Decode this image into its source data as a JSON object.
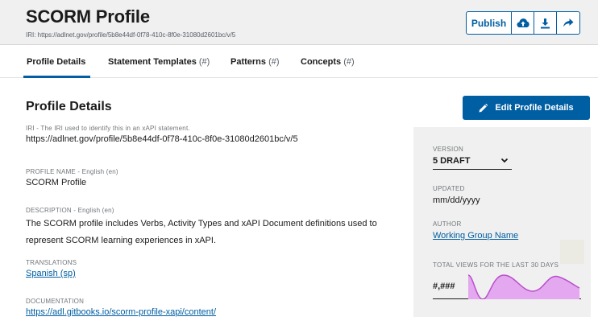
{
  "header": {
    "title": "SCORM Profile",
    "iri_line": "IRI: https://adlnet.gov/profile/5b8e44df-0f78-410c-8f0e-31080d2601bc/v/5",
    "toolbar": {
      "publish_label": "Publish",
      "icons": [
        "cloud-upload-icon",
        "download-icon",
        "share-icon"
      ]
    }
  },
  "tabs": [
    {
      "label": "Profile Details",
      "count": ""
    },
    {
      "label": "Statement Templates",
      "count": "(#)"
    },
    {
      "label": "Patterns",
      "count": "(#)"
    },
    {
      "label": "Concepts",
      "count": "(#)"
    }
  ],
  "main": {
    "section_title": "Profile Details",
    "edit_button": "Edit Profile Details",
    "iri": {
      "label": "IRI - The IRI used to identify this in an xAPI statement.",
      "value": "https://adlnet.gov/profile/5b8e44df-0f78-410c-8f0e-31080d2601bc/v/5"
    },
    "profile_name": {
      "label": "PROFILE NAME - English (en)",
      "value": "SCORM Profile"
    },
    "description": {
      "label": "DESCRIPTION - English (en)",
      "value": "The SCORM profile includes Verbs, Activity Types and xAPI Document definitions used to represent SCORM learning experiences in xAPI."
    },
    "translations": {
      "label": "TRANSLATIONS",
      "value": "Spanish (sp)"
    },
    "documentation": {
      "label": "DOCUMENTATION",
      "value": "https://adl.gitbooks.io/scorm-profile-xapi/content/"
    }
  },
  "sidebar": {
    "version": {
      "label": "VERSION",
      "value": "5 DRAFT"
    },
    "updated": {
      "label": "UPDATED",
      "value": "mm/dd/yyyy"
    },
    "author": {
      "label": "AUTHOR",
      "value": "Working Group Name"
    },
    "views": {
      "label": "TOTAL VIEWS FOR THE LAST 30 DAYS",
      "value": "#,###"
    }
  },
  "colors": {
    "primary": "#005ea2",
    "header_bg": "#f0f0f0",
    "sidebar_bg": "#f0f0f0",
    "sparkline_fill": "#e4a8f0",
    "sparkline_stroke": "#b84fc9"
  }
}
